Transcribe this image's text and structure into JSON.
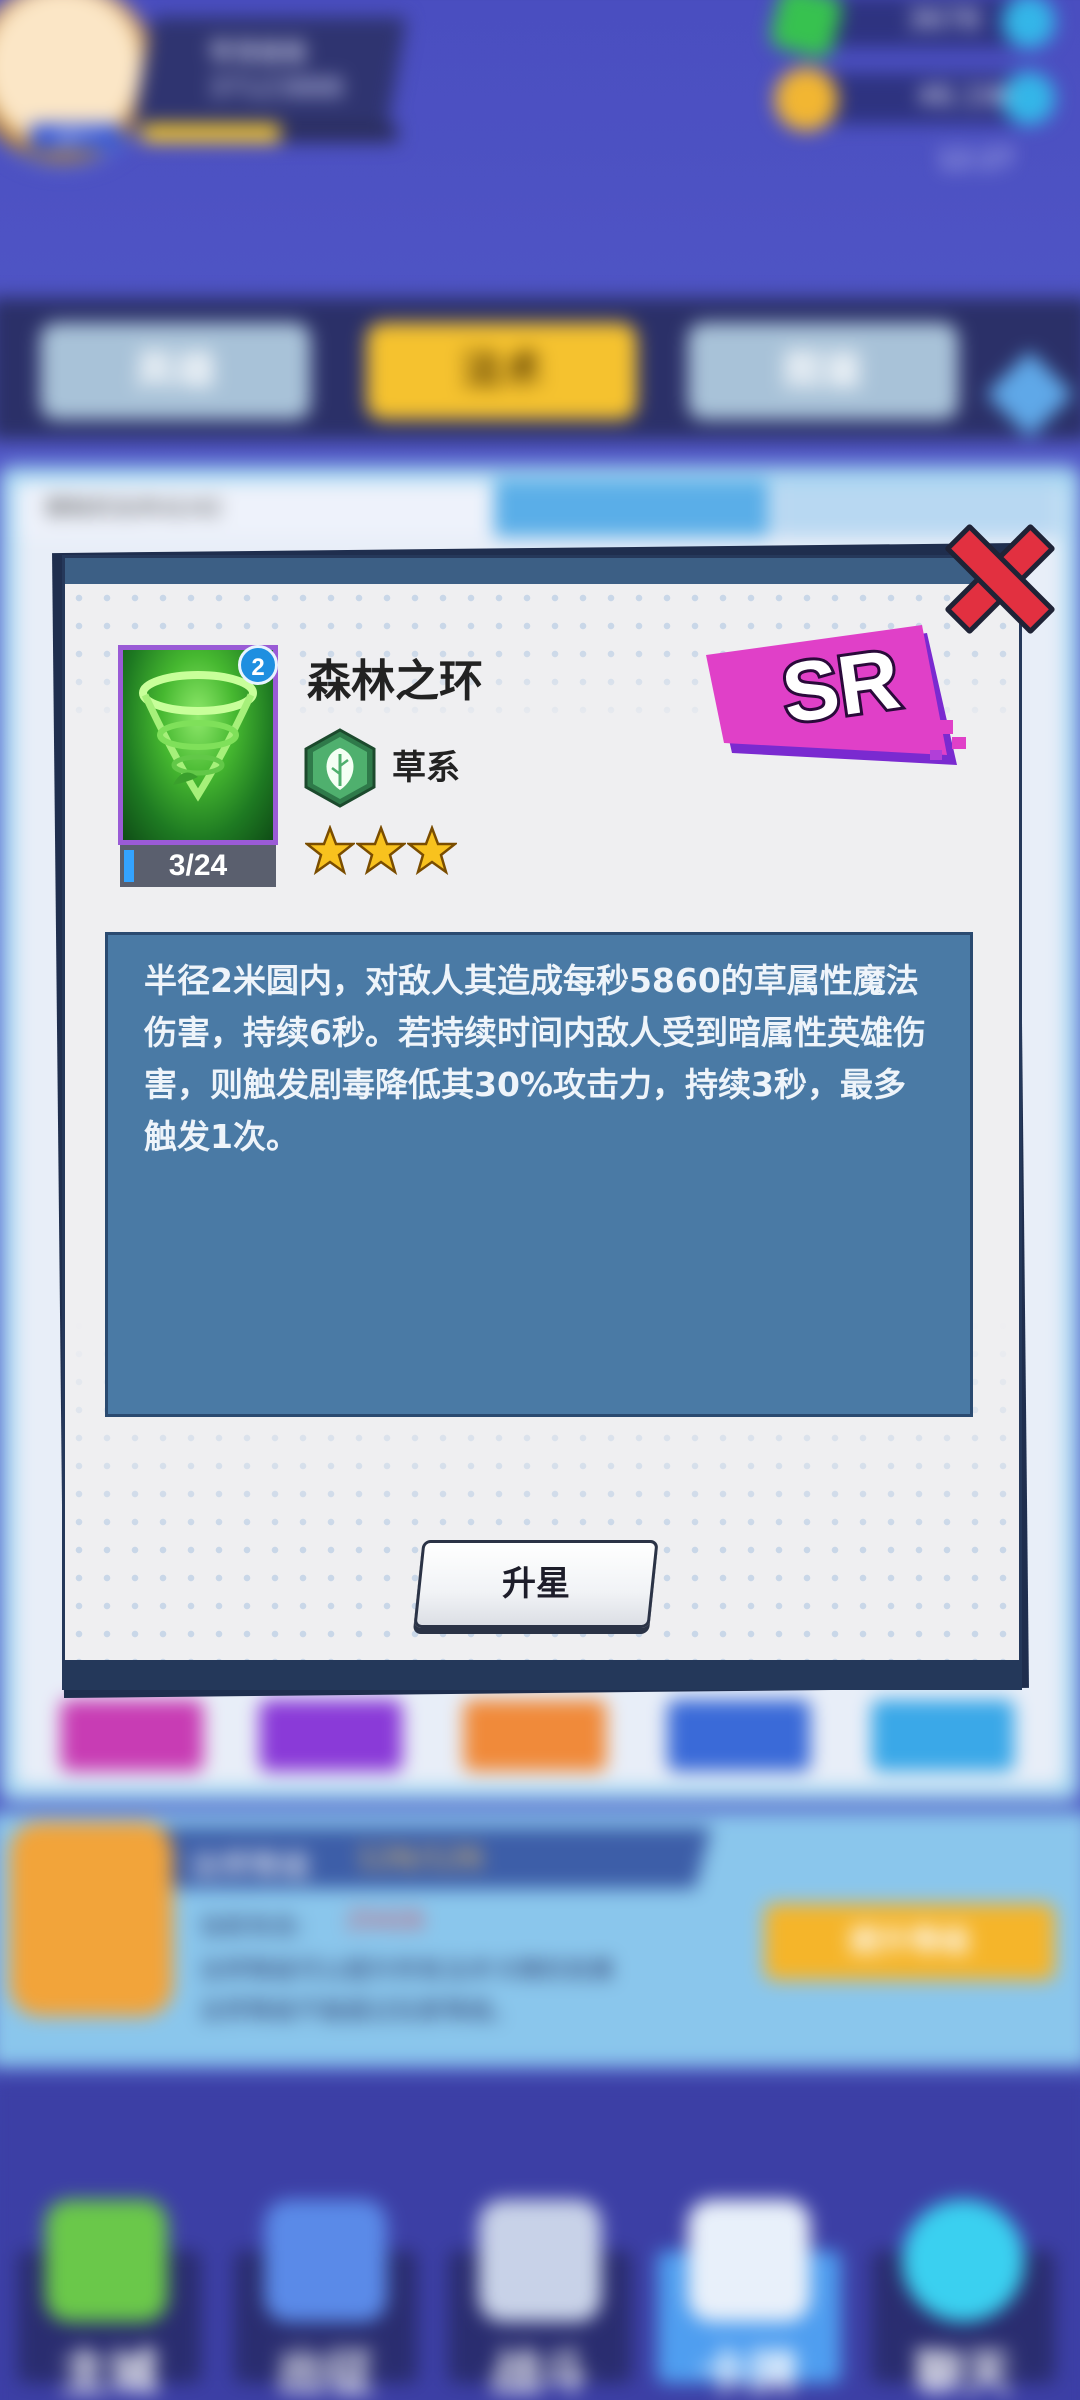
{
  "hud": {
    "player_name": "零落猫猫",
    "player_id": "37123888",
    "vip": "VIP 7",
    "gems": "3678",
    "coins": "46.1W",
    "clock": "12:27"
  },
  "tabs": {
    "hero": "英雄",
    "spell": "法术",
    "book": "图鉴"
  },
  "list": {
    "header": "拥有的法术42/42",
    "filter1": "",
    "filter2": ""
  },
  "bottom": {
    "title": "法师等级",
    "level": "126/126",
    "power_label": "当前攻击:",
    "power_value": "25426",
    "desc1": "法师等级可以提升所有法术卡牌的效果",
    "desc2": "法师等级不能超过玩家等级。",
    "button": "提升等级"
  },
  "nav": {
    "city": "主城",
    "expedition": "出征",
    "battle": "战斗",
    "cards": "卡牌",
    "chat": "聊天"
  },
  "modal": {
    "card_level": "2",
    "card_progress": "3/24",
    "card_progress_fraction": 0.125,
    "spell_name": "森林之环",
    "element": "草系",
    "element_icon": "leaf-icon",
    "stars": 3,
    "rarity": "SR",
    "rarity_color": "#e040c8",
    "description": "半径2米圆内，对敌人其造成每秒5860的草属性魔法伤害，持续6秒。若持续时间内敌人受到暗属性英雄伤害，则触发剧毒降低其30%攻击力，持续3秒，最多触发1次。",
    "upgrade_button": "升星"
  }
}
